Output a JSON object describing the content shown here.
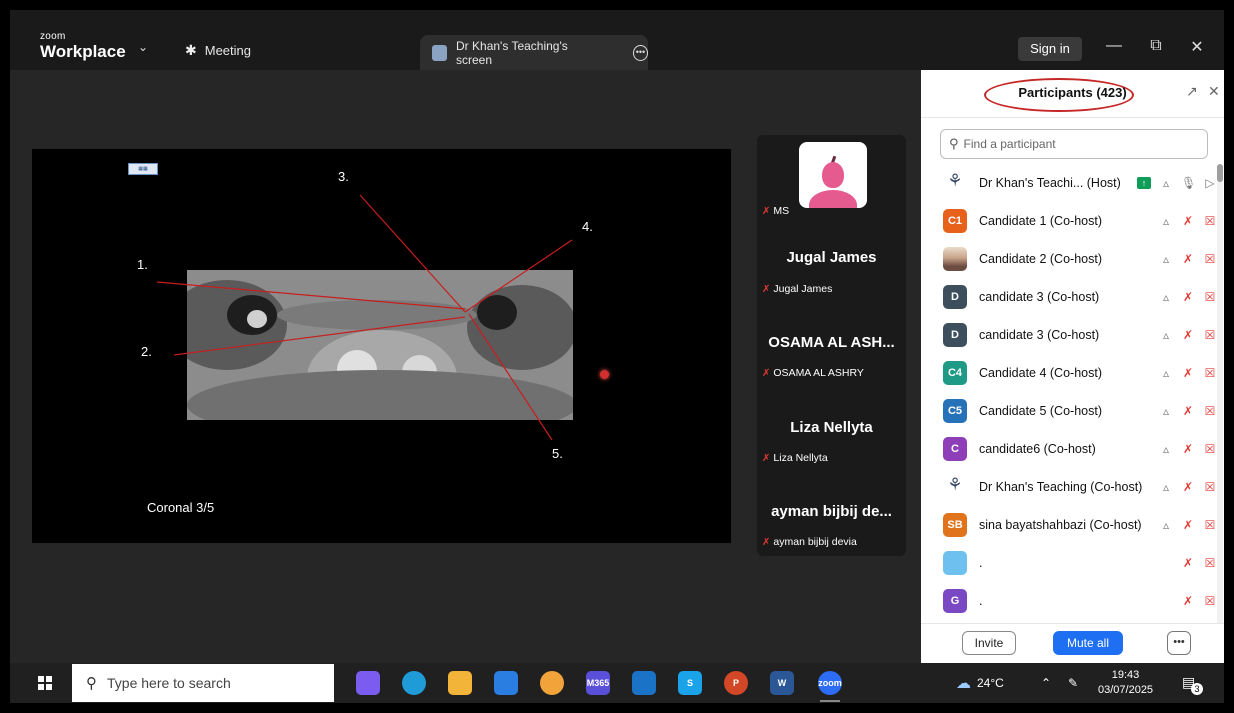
{
  "titlebar": {
    "brand_small": "zoom",
    "brand_big": "Workplace",
    "meeting_tab": "Meeting",
    "screen_tab": "Dr Khan's Teaching's screen",
    "sign_in": "Sign in"
  },
  "slide": {
    "labels": [
      "1.",
      "2.",
      "3.",
      "4.",
      "5."
    ],
    "caption": "Coronal 3/5"
  },
  "gallery": {
    "tiles": [
      {
        "big": "",
        "small": "MS"
      },
      {
        "big": "Jugal James",
        "small": "Jugal James"
      },
      {
        "big": "OSAMA AL ASH...",
        "small": "OSAMA AL ASHRY"
      },
      {
        "big": "Liza Nellyta",
        "small": "Liza Nellyta"
      },
      {
        "big": "ayman bijbij de...",
        "small": "ayman bijbij devia"
      }
    ]
  },
  "panel": {
    "title": "Participants (423)",
    "search_placeholder": "Find a participant",
    "participants": [
      {
        "avatar": "",
        "avatar_color": "#ffffff",
        "name": "Dr Khan's Teachi...  (Host)"
      },
      {
        "avatar": "C1",
        "avatar_color": "#e8611a",
        "name": "Candidate 1 (Co-host)"
      },
      {
        "avatar": "",
        "avatar_color": "#c9a48a",
        "name": "Candidate 2 (Co-host)"
      },
      {
        "avatar": "D",
        "avatar_color": "#3d4f5c",
        "name": "candidate 3 (Co-host)"
      },
      {
        "avatar": "D",
        "avatar_color": "#3d4f5c",
        "name": "candidate 3 (Co-host)"
      },
      {
        "avatar": "C4",
        "avatar_color": "#1e9a87",
        "name": "Candidate 4 (Co-host)"
      },
      {
        "avatar": "C5",
        "avatar_color": "#2672b8",
        "name": "Candidate 5 (Co-host)"
      },
      {
        "avatar": "C",
        "avatar_color": "#8e3fb8",
        "name": "candidate6 (Co-host)"
      },
      {
        "avatar": "",
        "avatar_color": "#ffffff",
        "name": "Dr Khan's Teaching (Co-host)"
      },
      {
        "avatar": "SB",
        "avatar_color": "#e0741c",
        "name": "sina bayatshahbazi (Co-host)"
      },
      {
        "avatar": "",
        "avatar_color": "#6ec1ef",
        "name": "."
      },
      {
        "avatar": "G",
        "avatar_color": "#7b48c4",
        "name": "."
      }
    ],
    "invite": "Invite",
    "mute_all": "Mute all"
  },
  "taskbar": {
    "search_placeholder": "Type here to search",
    "apps": [
      {
        "name": "copilot",
        "label": "",
        "color": "#7b5cf0"
      },
      {
        "name": "edge",
        "label": "",
        "color": "#1f9bd8"
      },
      {
        "name": "file-explorer",
        "label": "",
        "color": "#f2b53a"
      },
      {
        "name": "dropbox",
        "label": "",
        "color": "#2a7de1"
      },
      {
        "name": "chrome",
        "label": "",
        "color": "#f2a33a"
      },
      {
        "name": "m365",
        "label": "M365",
        "color": "#5a4fd8"
      },
      {
        "name": "outlook",
        "label": "",
        "color": "#1b73c8"
      },
      {
        "name": "skype",
        "label": "S",
        "color": "#1aa3e8"
      },
      {
        "name": "powerpoint",
        "label": "P",
        "color": "#d24726"
      },
      {
        "name": "word",
        "label": "W",
        "color": "#2b5797"
      },
      {
        "name": "zoom",
        "label": "zoom",
        "color": "#2d6cf5"
      }
    ],
    "temperature": "24°C",
    "time": "19:43",
    "date": "03/07/2025",
    "notifications": "3"
  }
}
